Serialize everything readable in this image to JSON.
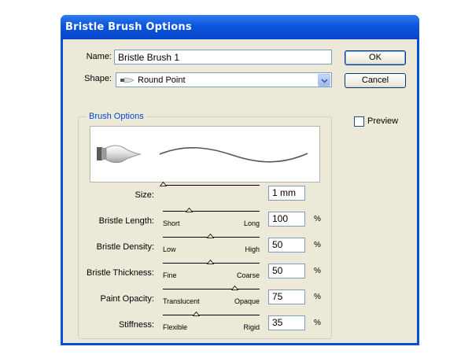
{
  "window": {
    "title": "Bristle Brush Options"
  },
  "form": {
    "name_label": "Name:",
    "name_value": "Bristle Brush 1",
    "shape_label": "Shape:",
    "shape_value": "Round Point",
    "shape_icon": "round-point-brush-icon"
  },
  "buttons": {
    "ok": "OK",
    "cancel": "Cancel"
  },
  "preview": {
    "label": "Preview",
    "checked": false
  },
  "group": {
    "title": "Brush Options"
  },
  "sliders": [
    {
      "label": "Size:",
      "low": "",
      "high": "",
      "value": "1 mm",
      "unit": "",
      "level": 0.0
    },
    {
      "label": "Bristle Length:",
      "low": "Short",
      "high": "Long",
      "value": "100",
      "unit": "%",
      "level": 0.27
    },
    {
      "label": "Bristle Density:",
      "low": "Low",
      "high": "High",
      "value": "50",
      "unit": "%",
      "level": 0.49
    },
    {
      "label": "Bristle Thickness:",
      "low": "Fine",
      "high": "Coarse",
      "value": "50",
      "unit": "%",
      "level": 0.49
    },
    {
      "label": "Paint Opacity:",
      "low": "Translucent",
      "high": "Opaque",
      "value": "75",
      "unit": "%",
      "level": 0.74
    },
    {
      "label": "Stiffness:",
      "low": "Flexible",
      "high": "Rigid",
      "value": "35",
      "unit": "%",
      "level": 0.34
    }
  ],
  "colors": {
    "titlebar": "#0a4fd8",
    "face": "#ece9d8",
    "group_title": "#0046d5"
  }
}
